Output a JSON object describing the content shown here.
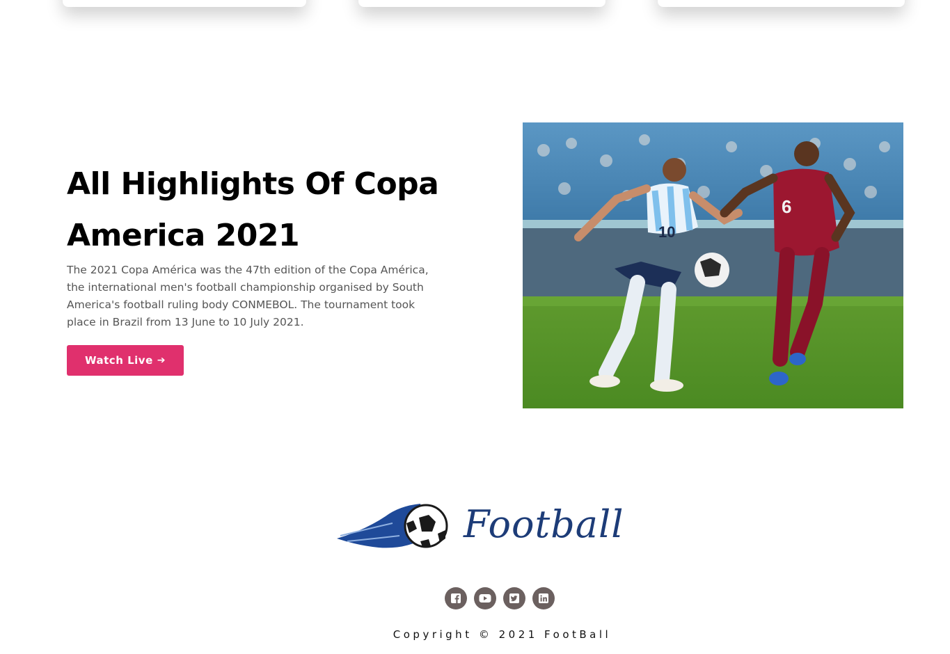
{
  "hero": {
    "title": "All Highlights Of Copa America 2021",
    "description": "The 2021 Copa América was the 47th edition of the Copa América, the international men's football championship organised by South America's football ruling body CONMEBOL. The tournament took place in Brazil from 13 June to 10 July 2021.",
    "button_label": "Watch Live",
    "button_icon": "arrow-right-icon",
    "accent_color": "#e0306d"
  },
  "photo": {
    "player_left_number": "10",
    "player_right_number": "6"
  },
  "footer": {
    "logo_text": "Football",
    "social_icons": [
      "facebook-icon",
      "youtube-icon",
      "twitter-icon",
      "linkedin-icon"
    ],
    "copyright": "Copyright © 2021 FootBall"
  }
}
